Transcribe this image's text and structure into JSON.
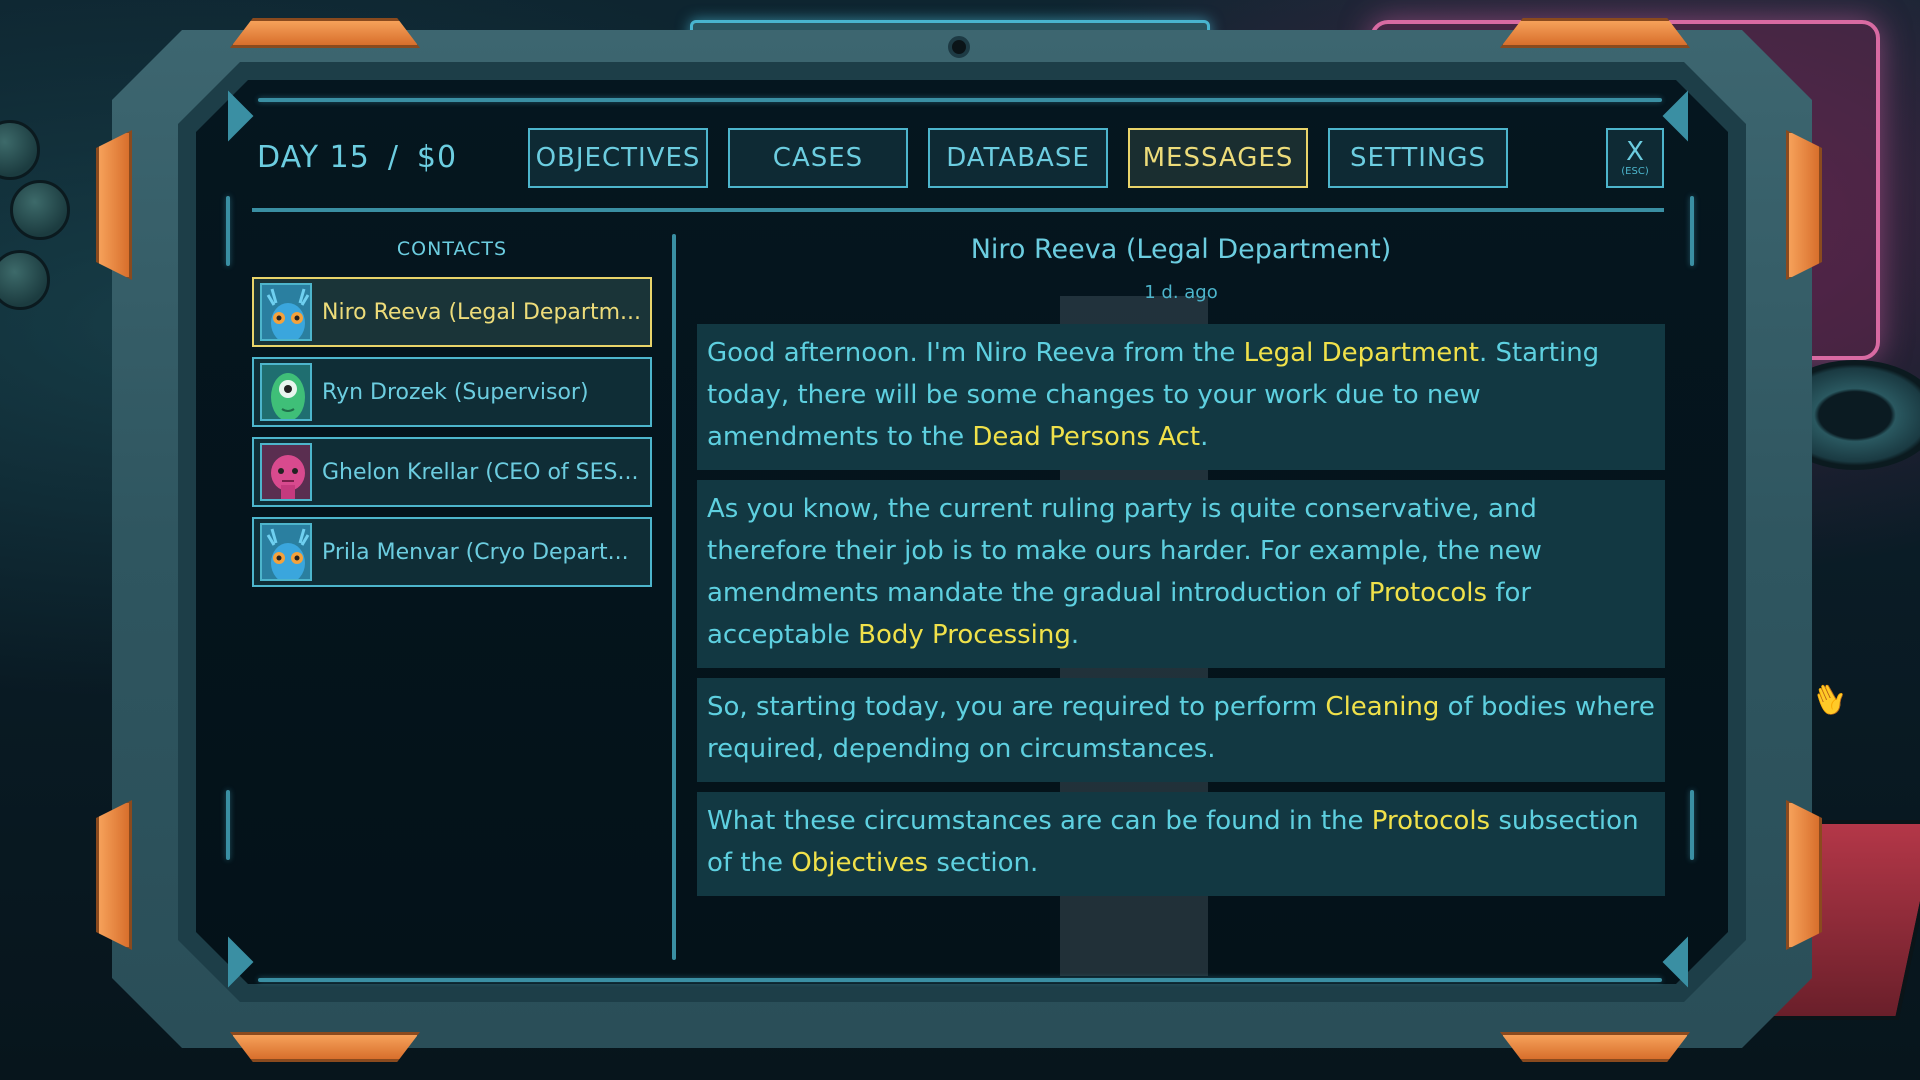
{
  "header": {
    "day": "DAY 15",
    "separator": "/",
    "money": "$0"
  },
  "tabs": [
    {
      "label": "OBJECTIVES"
    },
    {
      "label": "CASES"
    },
    {
      "label": "DATABASE"
    },
    {
      "label": "MESSAGES",
      "active": true
    },
    {
      "label": "SETTINGS"
    }
  ],
  "close": {
    "label": "X",
    "hint": "(ESC)"
  },
  "contacts": {
    "title": "CONTACTS",
    "items": [
      {
        "name": "Niro Reeva (Legal Department)",
        "display": "Niro Reeva (Legal Departm...",
        "avatar": "blue-alien-avatar",
        "active": true
      },
      {
        "name": "Ryn Drozek (Supervisor)",
        "display": "Ryn Drozek (Supervisor)",
        "avatar": "green-cyclops-avatar"
      },
      {
        "name": "Ghelon Krellar (CEO of SES...)",
        "display": "Ghelon Krellar (CEO of SES...",
        "avatar": "pink-alien-avatar"
      },
      {
        "name": "Prila Menvar (Cryo Depart...)",
        "display": "Prila Menvar (Cryo Depart...",
        "avatar": "blue-alien-avatar"
      }
    ]
  },
  "message": {
    "sender": "Niro Reeva (Legal Department)",
    "time": "1 d. ago",
    "paragraphs": [
      {
        "p1a": "Good afternoon. I'm Niro Reeva from the ",
        "p1b": "Legal Department",
        "p1c": ". Starting today, there will be some changes to your work due to new amendments to the ",
        "p1d": "Dead Persons Act",
        "p1e": "."
      },
      {
        "p2a": "As you know, the current ruling party is quite conservative, and therefore their job is to make ours harder. For example, the new amendments mandate the gradual introduction of ",
        "p2b": "Protocols",
        "p2c": " for acceptable ",
        "p2d": "Body Processing",
        "p2e": "."
      },
      {
        "p3a": "So, starting today, you are required to perform ",
        "p3b": "Cleaning",
        "p3c": " of bodies where required, depending on circumstances."
      },
      {
        "p4a": "What these circumstances are can be found in the ",
        "p4b": "Protocols",
        "p4c": " subsection of the ",
        "p4d": "Objectives",
        "p4e": " section."
      }
    ]
  },
  "colors": {
    "accent": "#6ccde0",
    "highlight": "#f0e14a",
    "active_border": "#e9d46a",
    "frame_orange": "#f6a15a"
  }
}
